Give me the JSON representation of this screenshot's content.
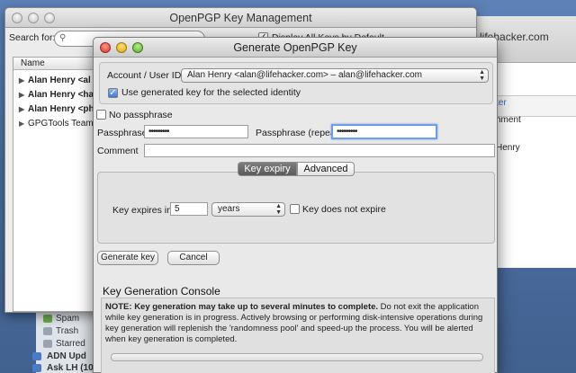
{
  "background_mail": {
    "site": "lifehacker.com",
    "partial_link": "ter",
    "partial_col": "hment",
    "partial_name": "Henry",
    "sidebar": [
      {
        "label": "Spam",
        "color": "#6aa84f"
      },
      {
        "label": "Trash",
        "color": "#9aa4b0"
      },
      {
        "label": "Starred",
        "color": "#9aa4b0"
      },
      {
        "label": "ADN Upd",
        "color": "#4a7bc8"
      },
      {
        "label": "Ask LH (10)",
        "color": "#4a7bc8"
      }
    ]
  },
  "mgmt": {
    "title": "OpenPGP Key Management",
    "search_label": "Search for:",
    "display_all_label": "Display All Keys by Default",
    "display_all_checked": "✓",
    "column_name": "Name",
    "keys": [
      {
        "label": "Alan Henry <al"
      },
      {
        "label": "Alan Henry <ha"
      },
      {
        "label": "Alan Henry <ph"
      },
      {
        "label": "GPGTools Team"
      }
    ]
  },
  "dialog": {
    "title": "Generate OpenPGP Key",
    "account_label": "Account / User ID",
    "account_value": "Alan Henry <alan@lifehacker.com> – alan@lifehacker.com",
    "use_generated_label": "Use generated key for the selected identity",
    "use_generated_checked": "✓",
    "no_passphrase_label": "No passphrase",
    "passphrase_label": "Passphrase",
    "passphrase_value": "•••••••••",
    "passphrase_repeat_label": "Passphrase (repeat)",
    "passphrase_repeat_value": "•••••••••",
    "comment_label": "Comment",
    "comment_value": "",
    "tabs": {
      "key_expiry": "Key expiry",
      "advanced": "Advanced"
    },
    "expires_label": "Key expires in",
    "expires_value": "5",
    "expires_unit": "years",
    "no_expire_label": "Key does not expire",
    "generate_button": "Generate key",
    "cancel_button": "Cancel",
    "console_heading": "Key Generation Console",
    "console_bold": "NOTE: Key generation may take up to several minutes to complete.",
    "console_text": " Do not exit the application while key generation is in progress. Actively browsing or performing disk-intensive operations during key generation will replenish the 'randomness pool' and speed-up the process. You will be alerted when key generation is completed."
  }
}
